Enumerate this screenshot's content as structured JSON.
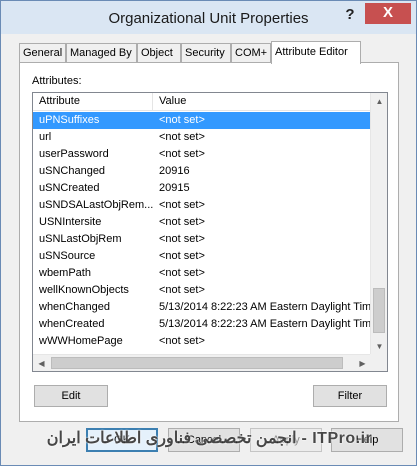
{
  "window": {
    "title": "Organizational Unit Properties",
    "help_glyph": "?",
    "close_glyph": "X"
  },
  "tabs": [
    {
      "label": "General"
    },
    {
      "label": "Managed By"
    },
    {
      "label": "Object"
    },
    {
      "label": "Security"
    },
    {
      "label": "COM+"
    },
    {
      "label": "Attribute Editor",
      "active": true
    }
  ],
  "attributes_label": "Attributes:",
  "list": {
    "columns": {
      "attribute": "Attribute",
      "value": "Value"
    },
    "rows": [
      {
        "attribute": "uPNSuffixes",
        "value": "<not set>",
        "selected": true
      },
      {
        "attribute": "url",
        "value": "<not set>"
      },
      {
        "attribute": "userPassword",
        "value": "<not set>"
      },
      {
        "attribute": "uSNChanged",
        "value": "20916"
      },
      {
        "attribute": "uSNCreated",
        "value": "20915"
      },
      {
        "attribute": "uSNDSALastObjRem...",
        "value": "<not set>"
      },
      {
        "attribute": "USNIntersite",
        "value": "<not set>"
      },
      {
        "attribute": "uSNLastObjRem",
        "value": "<not set>"
      },
      {
        "attribute": "uSNSource",
        "value": "<not set>"
      },
      {
        "attribute": "wbemPath",
        "value": "<not set>"
      },
      {
        "attribute": "wellKnownObjects",
        "value": "<not set>"
      },
      {
        "attribute": "whenChanged",
        "value": "5/13/2014 8:22:23 AM Eastern Daylight Tim"
      },
      {
        "attribute": "whenCreated",
        "value": "5/13/2014 8:22:23 AM Eastern Daylight Tim"
      },
      {
        "attribute": "wWWHomePage",
        "value": "<not set>"
      }
    ]
  },
  "buttons": {
    "edit": "Edit",
    "filter": "Filter",
    "ok": "OK",
    "cancel": "Cancel",
    "apply": "Apply",
    "help": "Help"
  },
  "watermark": "ITPro.ir - انجمن تخصصی فناوری اطلاعات ایران",
  "colors": {
    "selection": "#3399ff",
    "close_button": "#c75050",
    "titlebar": "#dae6f3"
  }
}
